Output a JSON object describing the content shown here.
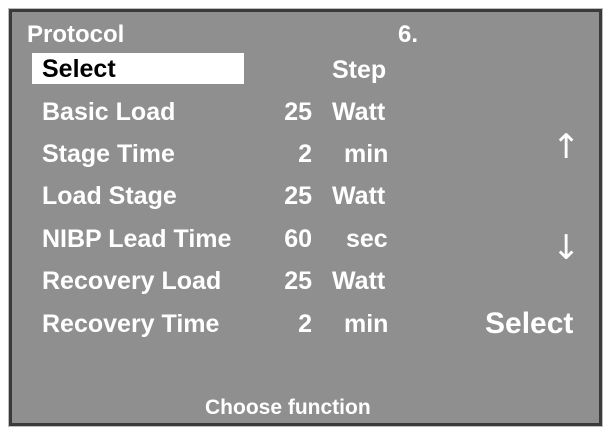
{
  "header": {
    "title": "Protocol",
    "page_number": "6."
  },
  "menu": {
    "selected_item": "Select",
    "column_header": "Step"
  },
  "rows": [
    {
      "label": "Basic Load",
      "value": "25",
      "unit": "Watt"
    },
    {
      "label": "Stage Time",
      "value": "2",
      "unit": "min"
    },
    {
      "label": "Load Stage",
      "value": "25",
      "unit": "Watt"
    },
    {
      "label": "NIBP Lead Time",
      "value": "60",
      "unit": "sec"
    },
    {
      "label": "Recovery Load",
      "value": "25",
      "unit": "Watt"
    },
    {
      "label": "Recovery Time",
      "value": "2",
      "unit": "min"
    }
  ],
  "softkeys": {
    "up": "↑",
    "down": "↓",
    "select": "Select"
  },
  "status": {
    "prompt": "Choose function"
  },
  "colors": {
    "background": "#8f8f8f",
    "text": "#ffffff",
    "highlight": "#ffffff",
    "highlight_text": "#000000"
  }
}
